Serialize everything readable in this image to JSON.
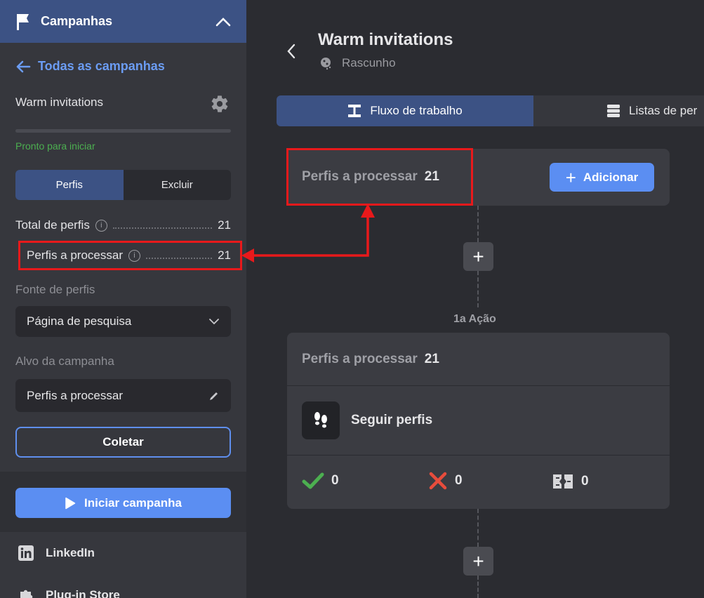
{
  "sidebar": {
    "header_title": "Campanhas",
    "back_label": "Todas as campanhas",
    "campaign_name": "Warm invitations",
    "progress": 0,
    "status": "Pronto para iniciar",
    "segments": [
      "Perfis",
      "Excluir"
    ],
    "stats": [
      {
        "label": "Total de perfis",
        "value": "21"
      },
      {
        "label": "Perfis a processar",
        "value": "21"
      }
    ],
    "source_label": "Fonte de perfis",
    "source_value": "Página de pesquisa",
    "target_label": "Alvo da campanha",
    "target_value": "Perfis a processar",
    "collect_label": "Coletar",
    "start_label": "Iniciar campanha",
    "nav": [
      "LinkedIn",
      "Plug-in Store"
    ]
  },
  "main": {
    "title": "Warm invitations",
    "draft_label": "Rascunho",
    "tabs": [
      "Fluxo de trabalho",
      "Listas de per"
    ],
    "queue": {
      "label": "Perfis a processar",
      "count": "21",
      "add_label": "Adicionar"
    },
    "action_label": "1a Ação",
    "action_card": {
      "label": "Perfis a processar",
      "count": "21",
      "action_name": "Seguir perfis",
      "success": "0",
      "failed": "0",
      "skipped": "0"
    }
  },
  "colors": {
    "accent": "#5b8ef2",
    "header": "#3c5284",
    "success": "#4caf50",
    "error": "#e8191b"
  }
}
